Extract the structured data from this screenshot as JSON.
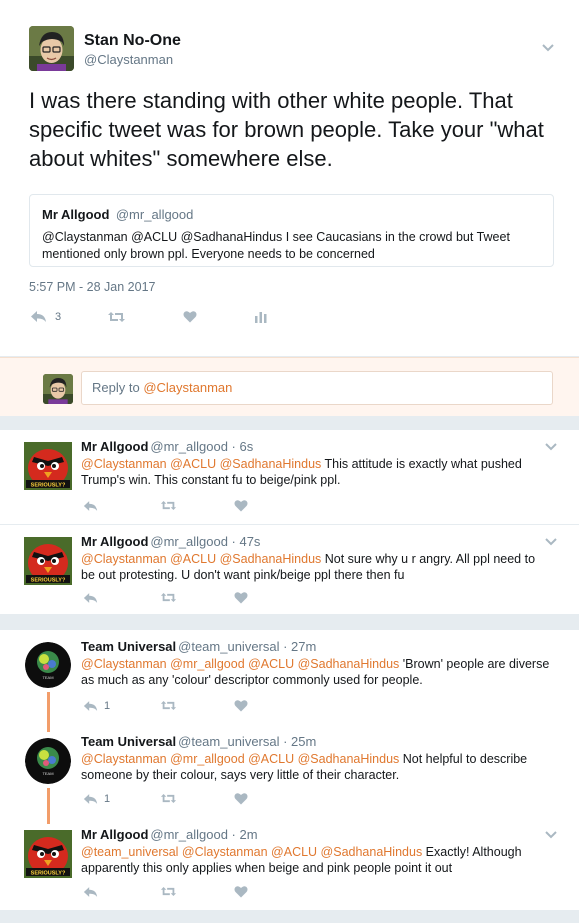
{
  "main_tweet": {
    "author_name": "Stan No-One",
    "author_handle": "@Claystanman",
    "text": "I was there standing with other white people. That specific tweet was for brown people. Take your \"what about whites\" somewhere else.",
    "quote": {
      "name": "Mr Allgood",
      "handle": "@mr_allgood",
      "text": "@Claystanman @ACLU @SadhanaHindus  I see Caucasians in the crowd but Tweet mentioned only brown ppl. Everyone needs to be concerned"
    },
    "timestamp": "5:57 PM - 28 Jan 2017",
    "reply_count": "3"
  },
  "reply_box": {
    "prefix": "Reply to ",
    "mention": "@Claystanman"
  },
  "replies": [
    {
      "name": "Mr Allgood",
      "meta": "@mr_allgood · 6s",
      "mentions": "@Claystanman @ACLU @SadhanaHindus",
      "text": " This attitude is exactly what pushed Trump's win. This constant fu to beige/pink ppl.",
      "reply_count": ""
    },
    {
      "name": "Mr Allgood",
      "meta": "@mr_allgood · 47s",
      "mentions": "@Claystanman @ACLU @SadhanaHindus",
      "text": " Not sure why u r angry. All ppl need to be out protesting. U don't want pink/beige ppl there then fu",
      "reply_count": ""
    },
    {
      "name": "Team Universal",
      "meta": "@team_universal · 27m",
      "mentions": "@Claystanman @mr_allgood @ACLU @SadhanaHindus",
      "text": "  'Brown' people are diverse as much as any 'colour' descriptor commonly used for people.",
      "reply_count": "1"
    },
    {
      "name": "Team Universal",
      "meta": "@team_universal · 25m",
      "mentions": "@Claystanman @mr_allgood @ACLU @SadhanaHindus",
      "text": " Not helpful to describe someone by their colour, says very little of their character.",
      "reply_count": "1"
    },
    {
      "name": "Mr Allgood",
      "meta": "@mr_allgood · 2m",
      "mentions": "@team_universal @Claystanman @ACLU @SadhanaHindus",
      "text": " Exactly!  Although apparently this only applies when beige and pink people point it out",
      "reply_count": ""
    }
  ],
  "icons": {
    "reply": "reply-icon",
    "retweet": "retweet-icon",
    "like": "heart-icon",
    "analytics": "bar-chart-icon",
    "more": "chevron-down-icon"
  },
  "colors": {
    "mention": "#e0782f",
    "thread_line": "#f29d6a",
    "muted": "#657786",
    "icon": "#aab8c2"
  }
}
